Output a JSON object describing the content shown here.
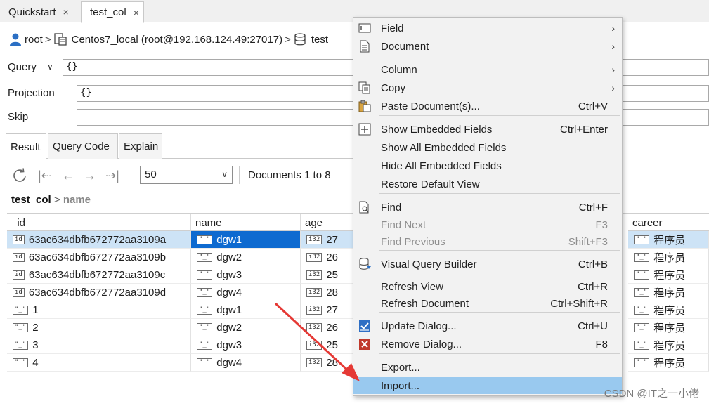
{
  "tabs": [
    {
      "label": "Quickstart",
      "close": "×"
    },
    {
      "label": "test_col",
      "close": "×"
    }
  ],
  "breadcrumb": {
    "user": "root",
    "connection": "Centos7_local (root@192.168.124.49:27017)",
    "collection": "test"
  },
  "filters": {
    "query_label": "Query",
    "query_value": "{}",
    "projection_label": "Projection",
    "projection_value": "{}",
    "skip_label": "Skip",
    "skip_value": ""
  },
  "result_tabs": [
    "Result",
    "Query Code",
    "Explain"
  ],
  "toolbar": {
    "page_size": "50",
    "documents_text": "Documents 1 to 8"
  },
  "path": {
    "collection": "test_col",
    "field": "name"
  },
  "grid": {
    "columns": [
      "_id",
      "name",
      "age",
      "career"
    ],
    "rows": [
      {
        "id": "63ac634dbfb672772aa3109a",
        "id_type": "id",
        "name": "dgw1",
        "age": "27",
        "career": "程序员"
      },
      {
        "id": "63ac634dbfb672772aa3109b",
        "id_type": "id",
        "name": "dgw2",
        "age": "26",
        "career": "程序员"
      },
      {
        "id": "63ac634dbfb672772aa3109c",
        "id_type": "id",
        "name": "dgw3",
        "age": "25",
        "career": "程序员"
      },
      {
        "id": "63ac634dbfb672772aa3109d",
        "id_type": "id",
        "name": "dgw4",
        "age": "28",
        "career": "程序员"
      },
      {
        "id": "1",
        "id_type": "str",
        "name": "dgw1",
        "age": "27",
        "career": "程序员"
      },
      {
        "id": "2",
        "id_type": "str",
        "name": "dgw2",
        "age": "26",
        "career": "程序员"
      },
      {
        "id": "3",
        "id_type": "str",
        "name": "dgw3",
        "age": "25",
        "career": "程序员"
      },
      {
        "id": "4",
        "id_type": "str",
        "name": "dgw4",
        "age": "28",
        "career": "程序员"
      }
    ]
  },
  "context_menu": {
    "items": [
      {
        "label": "Field",
        "shortcut": "",
        "submenu": true,
        "icon": "field-icon"
      },
      {
        "label": "Document",
        "shortcut": "",
        "submenu": true,
        "icon": "document-icon"
      },
      {
        "label": "Column",
        "shortcut": "",
        "submenu": true,
        "icon": ""
      },
      {
        "label": "Copy",
        "shortcut": "",
        "submenu": true,
        "icon": "copy-icon"
      },
      {
        "label": "Paste Document(s)...",
        "shortcut": "Ctrl+V",
        "submenu": false,
        "icon": "paste-icon"
      },
      {
        "label": "Show Embedded Fields",
        "shortcut": "Ctrl+Enter",
        "submenu": false,
        "icon": "plus-box-icon"
      },
      {
        "label": "Show All Embedded Fields",
        "shortcut": "",
        "submenu": false,
        "icon": ""
      },
      {
        "label": "Hide All Embedded Fields",
        "shortcut": "",
        "submenu": false,
        "icon": ""
      },
      {
        "label": "Restore Default View",
        "shortcut": "",
        "submenu": false,
        "icon": ""
      },
      {
        "label": "Find",
        "shortcut": "Ctrl+F",
        "submenu": false,
        "icon": "find-icon"
      },
      {
        "label": "Find Next",
        "shortcut": "F3",
        "submenu": false,
        "icon": "",
        "disabled": true
      },
      {
        "label": "Find Previous",
        "shortcut": "Shift+F3",
        "submenu": false,
        "icon": "",
        "disabled": true
      },
      {
        "label": "Visual Query Builder",
        "shortcut": "Ctrl+B",
        "submenu": false,
        "icon": "database-icon"
      },
      {
        "label": "Refresh View",
        "shortcut": "Ctrl+R",
        "submenu": false,
        "icon": ""
      },
      {
        "label": "Refresh Document",
        "shortcut": "Ctrl+Shift+R",
        "submenu": false,
        "icon": ""
      },
      {
        "label": "Update Dialog...",
        "shortcut": "Ctrl+U",
        "submenu": false,
        "icon": "update-icon"
      },
      {
        "label": "Remove Dialog...",
        "shortcut": "F8",
        "submenu": false,
        "icon": "remove-icon"
      },
      {
        "label": "Export...",
        "shortcut": "",
        "submenu": false,
        "icon": ""
      },
      {
        "label": "Import...",
        "shortcut": "",
        "submenu": false,
        "icon": "",
        "hover": true
      }
    ],
    "submenu_arrow": "›"
  },
  "type_tags": {
    "id": "id",
    "str": "\"_\"",
    "int": "i32"
  },
  "colors": {
    "selection": "#0e6ad0",
    "menu_hover": "#99c9ef",
    "arrow": "#e53935"
  },
  "watermark": "CSDN @IT之一小佬"
}
